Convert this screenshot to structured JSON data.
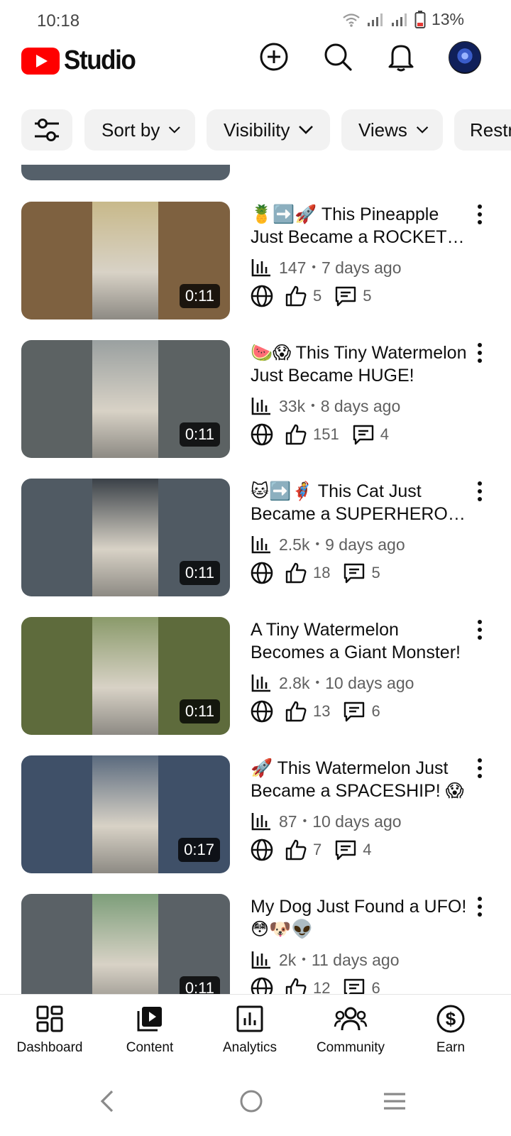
{
  "status_bar": {
    "time": "10:18",
    "battery": "13%"
  },
  "header": {
    "brand": "Studio",
    "icons": [
      "create-icon",
      "search-icon",
      "notifications-icon",
      "account-avatar"
    ]
  },
  "chips": {
    "filter_icon": "filter-sliders-icon",
    "sort": "Sort by",
    "visibility": "Visibility",
    "views": "Views",
    "restrictions": "Restrictions"
  },
  "videos": [
    {
      "title": "🍍➡️🚀 This Pineapple Just Became a ROCKET! 🔥",
      "views": "147",
      "age": "7 days ago",
      "likes": "5",
      "comments": "5",
      "duration": "0:11",
      "thumb_color": "#7e6140",
      "art_color": "#c8b98a"
    },
    {
      "title": "🍉😱 This Tiny Watermelon Just Became HUGE!",
      "views": "33k",
      "age": "8 days ago",
      "likes": "151",
      "comments": "4",
      "duration": "0:11",
      "thumb_color": "#5c6263",
      "art_color": "#9aa0a0"
    },
    {
      "title": "🐱➡️🦸 This Cat Just Became a SUPERHERO! 💥",
      "views": "2.5k",
      "age": "9 days ago",
      "likes": "18",
      "comments": "5",
      "duration": "0:11",
      "thumb_color": "#505a63",
      "art_color": "#3a4148"
    },
    {
      "title": "A Tiny Watermelon Becomes a Giant Monster!",
      "views": "2.8k",
      "age": "10 days ago",
      "likes": "13",
      "comments": "6",
      "duration": "0:11",
      "thumb_color": "#5e6b3c",
      "art_color": "#8a9a6a"
    },
    {
      "title": "🚀 This Watermelon Just Became a SPACESHIP! 😱",
      "views": "87",
      "age": "10 days ago",
      "likes": "7",
      "comments": "4",
      "duration": "0:17",
      "thumb_color": "#3f5068",
      "art_color": "#5a6a7e"
    },
    {
      "title": "My Dog Just Found a UFO! 😳🐶👽",
      "views": "2k",
      "age": "11 days ago",
      "likes": "12",
      "comments": "6",
      "duration": "0:11",
      "thumb_color": "#5a6166",
      "art_color": "#7d9e7a"
    }
  ],
  "bottom_nav": [
    {
      "label": "Dashboard",
      "icon": "dashboard-icon"
    },
    {
      "label": "Content",
      "icon": "content-icon"
    },
    {
      "label": "Analytics",
      "icon": "analytics-icon"
    },
    {
      "label": "Community",
      "icon": "community-icon"
    },
    {
      "label": "Earn",
      "icon": "earn-icon"
    }
  ]
}
